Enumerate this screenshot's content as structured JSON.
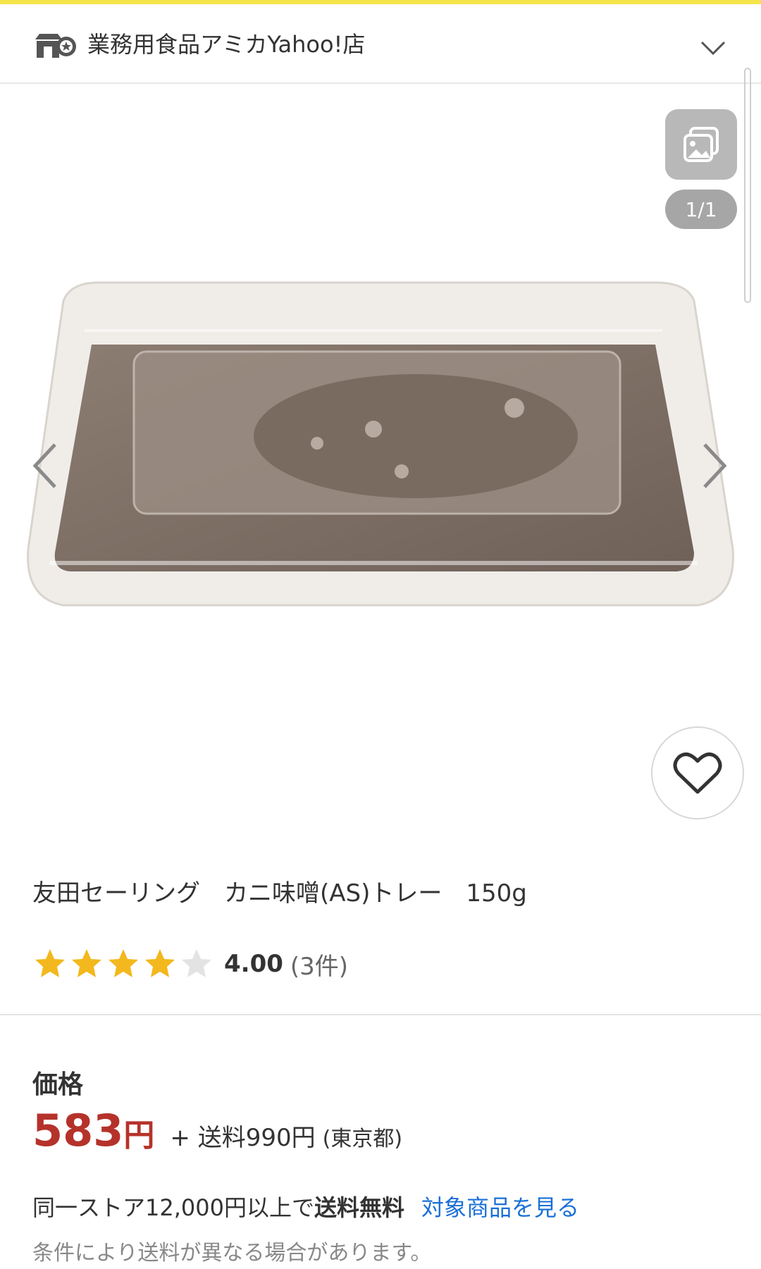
{
  "store": {
    "name": "業務用食品アミカYahoo!店",
    "icon": "store-badge-icon",
    "menu_icon": "chevron-down-icon"
  },
  "gallery": {
    "counter": "1/1",
    "gallery_icon": "gallery-icon",
    "prev_icon": "chevron-left-icon",
    "next_icon": "chevron-right-icon",
    "favorite_icon": "heart-icon"
  },
  "product": {
    "title": "友田セーリング　カニ味噌(AS)トレー　150g",
    "rating": {
      "value": "4.00",
      "stars": 4,
      "max_stars": 5,
      "count": "(3件)"
    }
  },
  "price": {
    "label": "価格",
    "amount": "583",
    "unit": "円",
    "shipping": "+ 送料990円",
    "shipping_region": "(東京都)"
  },
  "free_shipping": {
    "text": "同一ストア12,000円以上で",
    "strong": "送料無料",
    "link": "対象商品を見る"
  },
  "note": "条件により送料が異なる場合があります。",
  "colors": {
    "accent_bar": "#f6e54a",
    "price": "#b5322a",
    "link": "#1a6fd6",
    "star": "#f2b81d",
    "star_empty": "#e3e3e3"
  }
}
